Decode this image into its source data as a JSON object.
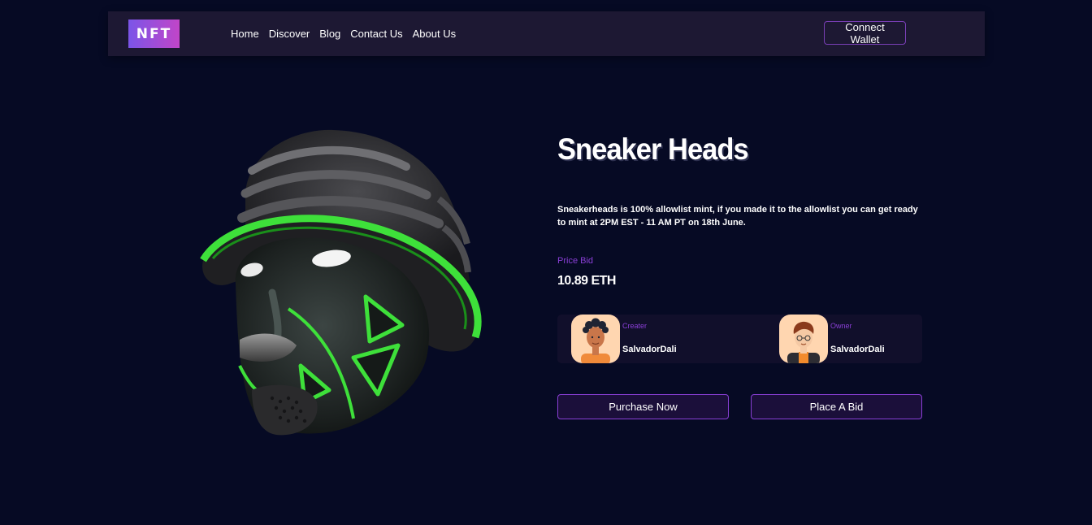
{
  "header": {
    "logo_text": "NFT",
    "nav": [
      {
        "label": "Home"
      },
      {
        "label": "Discover"
      },
      {
        "label": "Blog"
      },
      {
        "label": "Contact Us"
      },
      {
        "label": "About Us"
      }
    ],
    "connect_wallet_label": "Connect Wallet"
  },
  "main": {
    "title": "Sneaker Heads",
    "description": "Sneakerheads is 100% allowlist mint, if you made it to the allowlist you can get ready to mint at 2PM EST - 11 AM PT on 18th June.",
    "price_label": "Price Bid",
    "price_value": "10.89 ETH",
    "creator": {
      "role": "Creater",
      "name": "SalvadorDali"
    },
    "owner": {
      "role": "Owner",
      "name": "SalvadorDali"
    },
    "purchase_label": "Purchase Now",
    "bid_label": "Place A Bid"
  },
  "colors": {
    "background": "#060a24",
    "navbar": "#1d1833",
    "accent": "#8a3fd6",
    "button_fill": "#1b0f3a",
    "neon_green": "#3ee03a"
  },
  "icons": {
    "hero_image": "sneaker-head-mask-artwork",
    "creator_avatar": "creator-avatar-illustration",
    "owner_avatar": "owner-avatar-illustration"
  }
}
